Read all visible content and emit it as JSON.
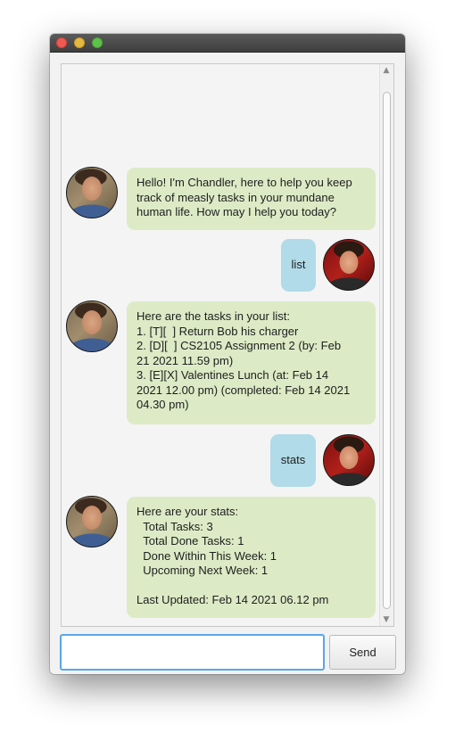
{
  "window": {
    "controls": [
      "close",
      "minimize",
      "maximize"
    ]
  },
  "chat": {
    "messages": [
      {
        "sender": "bot",
        "text": "Hello! I'm Chandler, here to help you keep\ntrack of measly tasks in your mundane\nhuman life. How may I help you today?"
      },
      {
        "sender": "user",
        "text": "list"
      },
      {
        "sender": "bot",
        "text": "Here are the tasks in your list:\n1. [T][  ] Return Bob his charger\n2. [D][  ] CS2105 Assignment 2 (by: Feb\n21 2021 11.59 pm)\n3. [E][X] Valentines Lunch (at: Feb 14\n2021 12.00 pm) (completed: Feb 14 2021\n04.30 pm)"
      },
      {
        "sender": "user",
        "text": "stats"
      },
      {
        "sender": "bot",
        "text": "Here are your stats:\n  Total Tasks: 3\n  Total Done Tasks: 1\n  Done Within This Week: 1\n  Upcoming Next Week: 1\n\nLast Updated: Feb 14 2021 06.12 pm"
      }
    ]
  },
  "input": {
    "value": "",
    "placeholder": ""
  },
  "send_button": {
    "label": "Send"
  },
  "colors": {
    "bot_bubble": "#dcebc6",
    "user_bubble": "#b1dbe8",
    "input_focus": "#5aa6e8"
  }
}
